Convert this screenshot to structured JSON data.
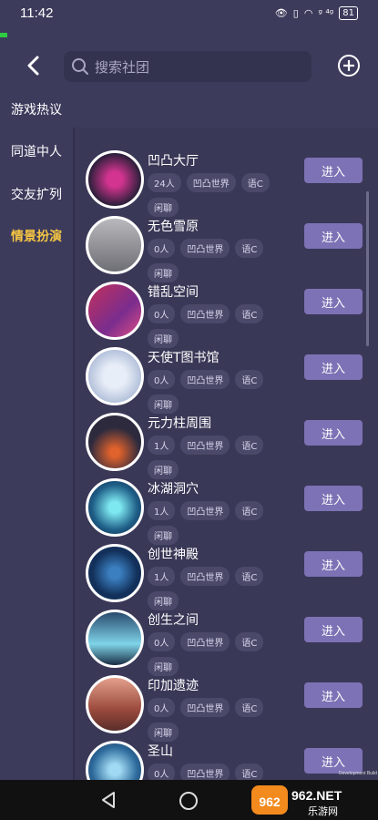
{
  "status_bar": {
    "time": "11:42",
    "battery": "81",
    "signal_text": "ᵍ ⁴ᵍ"
  },
  "search": {
    "placeholder": "搜索社团"
  },
  "sidebar": {
    "items": [
      {
        "label": "游戏热议",
        "active": false
      },
      {
        "label": "同道中人",
        "active": false
      },
      {
        "label": "交友扩列",
        "active": false
      },
      {
        "label": "情景扮演",
        "active": true
      }
    ]
  },
  "rooms": [
    {
      "name": "凹凸大厅",
      "tags": [
        "24人",
        "凹凸世界",
        "语C",
        "闲聊"
      ],
      "enter_label": "进入",
      "avatar": "pink-block-icon"
    },
    {
      "name": "无色雪原",
      "tags": [
        "0人",
        "凹凸世界",
        "语C",
        "闲聊"
      ],
      "enter_label": "进入",
      "avatar": "snow-forest-icon"
    },
    {
      "name": "错乱空间",
      "tags": [
        "0人",
        "凹凸世界",
        "语C",
        "闲聊"
      ],
      "enter_label": "进入",
      "avatar": "crystal-space-icon"
    },
    {
      "name": "天使T图书馆",
      "tags": [
        "0人",
        "凹凸世界",
        "语C",
        "闲聊"
      ],
      "enter_label": "进入",
      "avatar": "crystal-library-icon"
    },
    {
      "name": "元力柱周围",
      "tags": [
        "1人",
        "凹凸世界",
        "语C",
        "闲聊"
      ],
      "enter_label": "进入",
      "avatar": "volcano-icon"
    },
    {
      "name": "冰湖洞穴",
      "tags": [
        "1人",
        "凹凸世界",
        "语C",
        "闲聊"
      ],
      "enter_label": "进入",
      "avatar": "ice-cave-icon"
    },
    {
      "name": "创世神殿",
      "tags": [
        "1人",
        "凹凸世界",
        "语C",
        "闲聊"
      ],
      "enter_label": "进入",
      "avatar": "temple-icon"
    },
    {
      "name": "创生之间",
      "tags": [
        "0人",
        "凹凸世界",
        "语C",
        "闲聊"
      ],
      "enter_label": "进入",
      "avatar": "pillars-icon"
    },
    {
      "name": "印加遗迹",
      "tags": [
        "0人",
        "凹凸世界",
        "语C",
        "闲聊"
      ],
      "enter_label": "进入",
      "avatar": "ruins-icon"
    },
    {
      "name": "圣山",
      "tags": [
        "0人",
        "凹凸世界",
        "语C"
      ],
      "enter_label": "进入",
      "avatar": "sacred-mountain-icon"
    }
  ],
  "footer": {
    "dev_build": "Development Build"
  },
  "watermark": {
    "main": "962.NET",
    "sub": "乐游网"
  },
  "colors": {
    "accent": "#f4c542",
    "button": "#7c72b5",
    "background": "#3d3b5c"
  }
}
